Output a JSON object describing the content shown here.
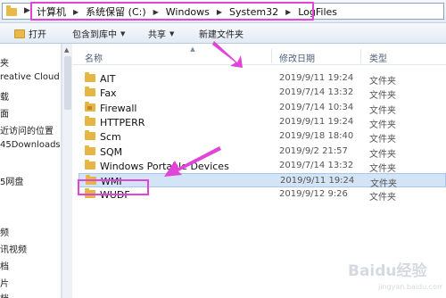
{
  "address": {
    "crumbs": [
      "计算机",
      "系统保留 (C:)",
      "Windows",
      "System32",
      "LogFiles"
    ]
  },
  "toolbar": {
    "open": "打开",
    "include": "包含到库中",
    "share": "共享",
    "new_folder": "新建文件夹"
  },
  "nav": {
    "items": [
      "夹",
      "reative Cloud",
      "载",
      "面",
      "近访问的位置",
      "45Downloads",
      "",
      "",
      "5网盘",
      "",
      "",
      "频",
      "讯视频",
      "档",
      "片",
      "档"
    ]
  },
  "columns": {
    "name": "名称",
    "date": "修改日期",
    "type": "类型"
  },
  "files": [
    {
      "name": "AIT",
      "date": "2019/9/11 19:24",
      "type": "文件夹",
      "locked": false
    },
    {
      "name": "Fax",
      "date": "2019/7/14 13:32",
      "type": "文件夹",
      "locked": false
    },
    {
      "name": "Firewall",
      "date": "2019/7/14 10:34",
      "type": "文件夹",
      "locked": true
    },
    {
      "name": "HTTPERR",
      "date": "2019/9/11 19:24",
      "type": "文件夹",
      "locked": false
    },
    {
      "name": "Scm",
      "date": "2019/9/18 18:40",
      "type": "文件夹",
      "locked": false
    },
    {
      "name": "SQM",
      "date": "2019/9/2 21:57",
      "type": "文件夹",
      "locked": false
    },
    {
      "name": "Windows Portable Devices",
      "date": "2019/7/14 13:32",
      "type": "文件夹",
      "locked": false
    },
    {
      "name": "WMI",
      "date": "2019/9/11 19:24",
      "type": "文件夹",
      "locked": false,
      "selected": true
    },
    {
      "name": "WUDF",
      "date": "2019/9/12 9:26",
      "type": "文件夹",
      "locked": false
    }
  ],
  "watermark": "Baidu经验",
  "colors": {
    "highlight": "#e044d8",
    "selection": "#d4e4f7",
    "folder": "#e6b645"
  }
}
